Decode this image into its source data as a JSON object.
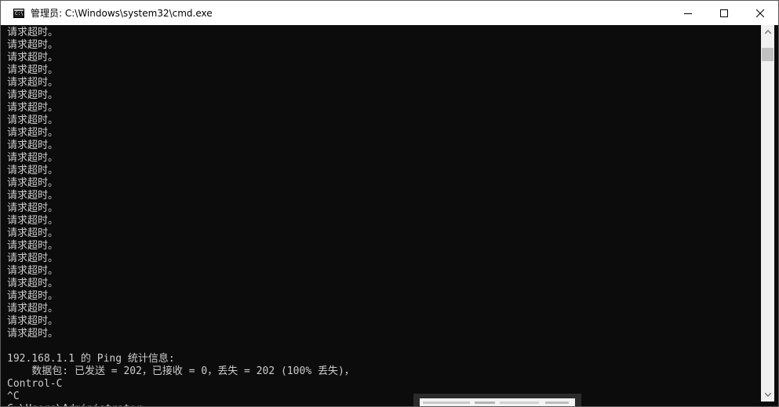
{
  "window": {
    "title": "管理员: C:\\Windows\\system32\\cmd.exe",
    "icon_label": "C:\\",
    "controls": [
      "minimize-icon",
      "maximize-icon",
      "close-icon"
    ]
  },
  "console": {
    "lines": [
      "请求超时。",
      "请求超时。",
      "请求超时。",
      "请求超时。",
      "请求超时。",
      "请求超时。",
      "请求超时。",
      "请求超时。",
      "请求超时。",
      "请求超时。",
      "请求超时。",
      "请求超时。",
      "请求超时。",
      "请求超时。",
      "请求超时。",
      "请求超时。",
      "请求超时。",
      "请求超时。",
      "请求超时。",
      "请求超时。",
      "请求超时。",
      "请求超时。",
      "请求超时。",
      "请求超时。",
      "请求超时。",
      "",
      "192.168.1.1 的 Ping 统计信息:",
      "    数据包: 已发送 = 202，已接收 = 0，丢失 = 202 (100% 丢失)，",
      "Control-C",
      "^C",
      "C:\\Users\\Administrator>"
    ]
  },
  "colors": {
    "console_bg": "#0c0c0c",
    "console_fg": "#cccccc",
    "titlebar_bg": "#ffffff"
  }
}
